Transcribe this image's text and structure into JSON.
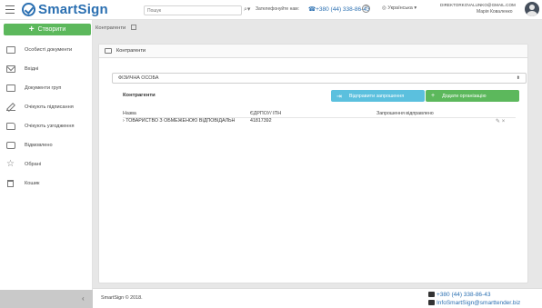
{
  "app": {
    "logo_text": "SmartSign",
    "brand_color": "#2a6fb1"
  },
  "header": {
    "search_placeholder": "Пошук",
    "phone_label": "Зателефонуйте нам:",
    "phone_number": "+380 (44) 338-86-43",
    "language": "Українська",
    "user_email": "DIREKTORKOVALUNKO@GMAIL.COM",
    "user_name": "Марія Коваленко"
  },
  "sidebar": {
    "create_label": "Створити",
    "items": [
      {
        "label": "Особисті документи",
        "icon": "folder-icon"
      },
      {
        "label": "Вхідні",
        "icon": "inbox-icon"
      },
      {
        "label": "Документи груп",
        "icon": "group-folder-icon"
      },
      {
        "label": "Очікують підписання",
        "icon": "pen-icon"
      },
      {
        "label": "Очікують узгодження",
        "icon": "thumbs-up-icon"
      },
      {
        "label": "Відмовлено",
        "icon": "comment-icon"
      },
      {
        "label": "Обрані",
        "icon": "star-icon"
      },
      {
        "label": "Кошик",
        "icon": "trash-icon"
      }
    ]
  },
  "breadcrumb": {
    "current": "Контрагенти"
  },
  "panel": {
    "title": "Контрагенти",
    "select_value": "ФІЗИЧНА ОСОБА",
    "section_title": "Контрагенти",
    "invite_button": "Відправити запрошення",
    "add_button": "Додати організацію",
    "columns": [
      "Назва",
      "ЄДРПОУ/ ІПН",
      "Запрошення відправлено"
    ],
    "rows": [
      {
        "name": "ТОВАРИСТВО З ОБМЕЖЕНОЮ ВІДПОВІДАЛЬН",
        "code": "41817392",
        "invited": ""
      }
    ]
  },
  "footer": {
    "copyright": "SmartSign © 2018.",
    "phone": "+380 (44) 338-86-43",
    "email": "InfoSmartSign@smarttender.biz"
  }
}
